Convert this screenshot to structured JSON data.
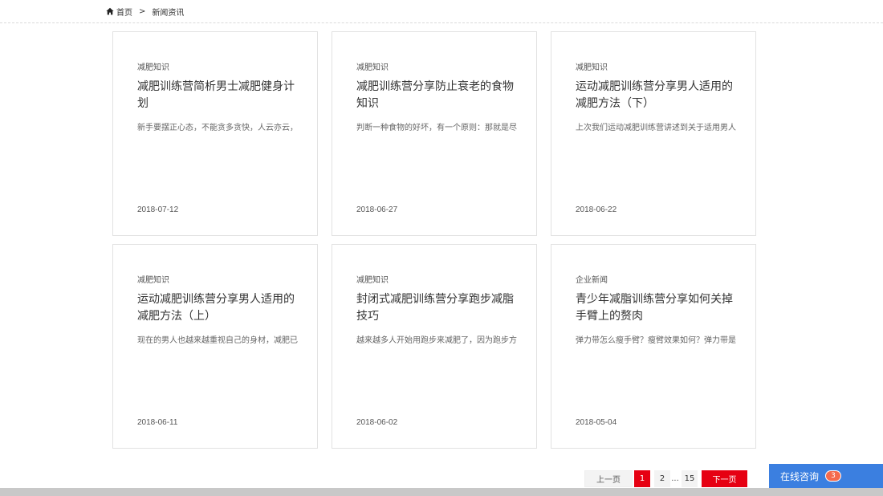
{
  "breadcrumb": {
    "home": "首页",
    "separator": ">",
    "current": "新闻资讯"
  },
  "cards": [
    {
      "category": "减肥知识",
      "title": "减肥训练营简析男士减肥健身计划",
      "summary": "新手要摆正心态，不能贪多贪快，人云亦云，",
      "date": "2018-07-12"
    },
    {
      "category": "减肥知识",
      "title": "减肥训练营分享防止衰老的食物知识",
      "summary": "判断一种食物的好坏，有一个原则：那就是尽",
      "date": "2018-06-27"
    },
    {
      "category": "减肥知识",
      "title": "运动减肥训练营分享男人适用的减肥方法（下）",
      "summary": "上次我们运动减肥训练营讲述到关于适用男人",
      "date": "2018-06-22"
    },
    {
      "category": "减肥知识",
      "title": "运动减肥训练营分享男人适用的减肥方法（上）",
      "summary": "现在的男人也越来越重视自己的身材，减肥已",
      "date": "2018-06-11"
    },
    {
      "category": "减肥知识",
      "title": "封闭式减肥训练营分享跑步减脂技巧",
      "summary": "越来越多人开始用跑步来减肥了，因为跑步方",
      "date": "2018-06-02"
    },
    {
      "category": "企业新闻",
      "title": "青少年减脂训练营分享如何关掉手臂上的赘肉",
      "summary": "弹力带怎么瘦手臂？瘦臂效果如何？弹力带是",
      "date": "2018-05-04"
    }
  ],
  "pagination": {
    "prev": "上一页",
    "page1": "1",
    "page2": "2",
    "ellipsis": "...",
    "last": "15",
    "next": "下一页"
  },
  "consult": {
    "label": "在线咨询",
    "badge": "3"
  },
  "colors": {
    "accent_red": "#e60012",
    "consult_blue": "#3b7fe0",
    "badge_orange": "#f46a4d"
  }
}
